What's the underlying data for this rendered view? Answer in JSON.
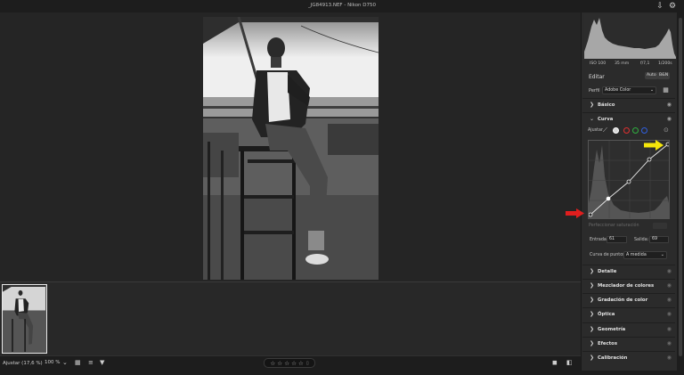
{
  "window": {
    "title": "_JG84913.NEF  -  Nikon D750"
  },
  "metadata": {
    "iso": "ISO 100",
    "focal": "35 mm",
    "aperture": "f/7,1",
    "shutter": "1/200s"
  },
  "header": {
    "editar": "Editar",
    "auto": "Auto",
    "bw": "B&N"
  },
  "profile": {
    "label": "Perfil",
    "value": "Adobe Color"
  },
  "sections": {
    "basico": "Básico",
    "curva": "Curva",
    "detalle": "Detalle",
    "mezclador": "Mezclador de colores",
    "gradacion": "Gradación de color",
    "optica": "Óptica",
    "geometria": "Geometría",
    "efectos": "Efectos",
    "calibracion": "Calibración"
  },
  "curve": {
    "ajustar_label": "Ajustar",
    "refine_saturation": "Perfeccionar saturación",
    "entrada_label": "Entrada:",
    "entrada_value": "61",
    "salida_label": "Salida:",
    "salida_value": "69",
    "points_label": "Curva de puntos:",
    "points_value": "A medida"
  },
  "bottom": {
    "zoom_fit": "Ajustar (17,6 %)",
    "zoom_pct": "100 %"
  },
  "rating": {
    "stars": "☆ ☆ ☆ ☆ ☆"
  },
  "colors": {
    "accent_yellow": "#f5e60a",
    "accent_red": "#e01e1e",
    "panel": "#2b2b2b"
  }
}
